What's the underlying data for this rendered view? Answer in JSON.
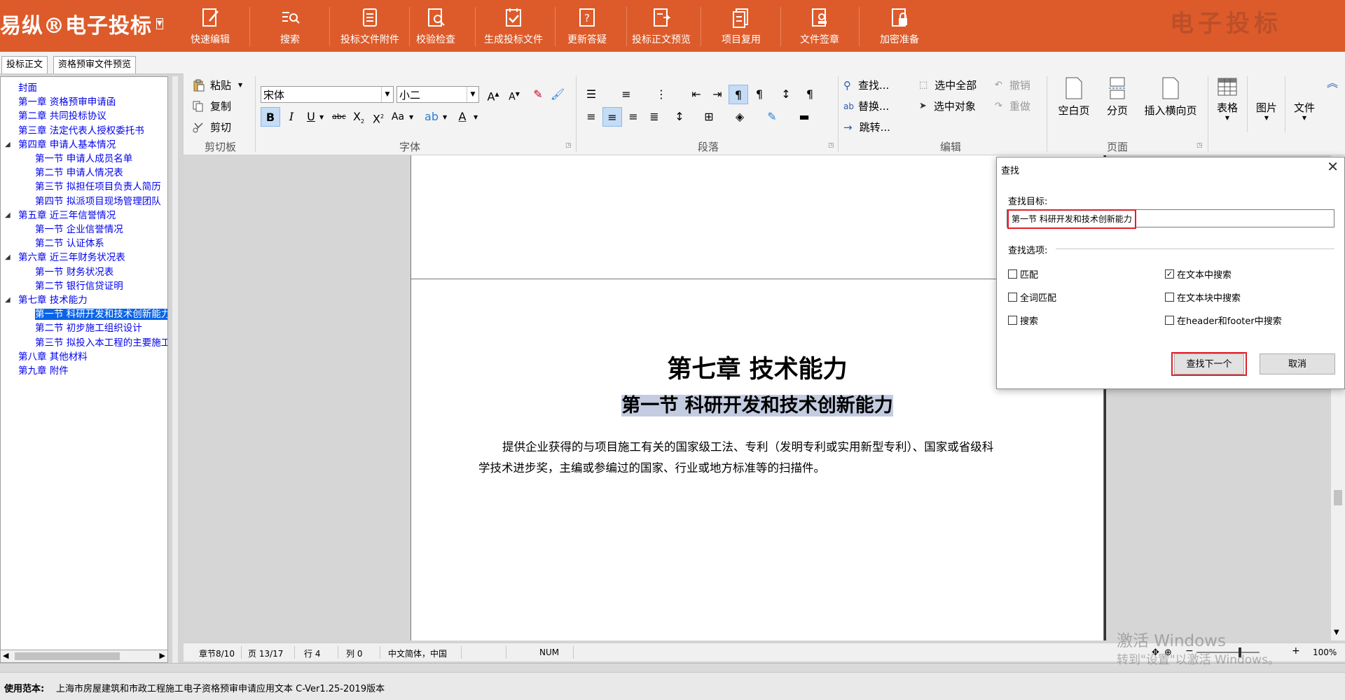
{
  "app": {
    "logo_text": "易纵®电子投标",
    "brand_watermark": "电子投标",
    "accent_color": "#dd5b2a"
  },
  "toolbar": [
    {
      "label": "快速编辑",
      "icon": "edit-icon"
    },
    {
      "label": "搜索",
      "icon": "search-icon"
    },
    {
      "label": "投标文件附件",
      "icon": "attachment-doc-icon"
    },
    {
      "label": "校验检查",
      "icon": "check-doc-icon"
    },
    {
      "label": "生成投标文件",
      "icon": "generate-doc-icon"
    },
    {
      "label": "更新答疑",
      "icon": "question-icon"
    },
    {
      "label": "投标正文预览",
      "icon": "preview-icon"
    },
    {
      "label": "项目复用",
      "icon": "reuse-icon"
    },
    {
      "label": "文件签章",
      "icon": "seal-icon"
    },
    {
      "label": "加密准备",
      "icon": "lock-doc-icon"
    }
  ],
  "tabs": [
    {
      "label": "投标正文",
      "active": true
    },
    {
      "label": "资格预审文件预览",
      "active": false
    }
  ],
  "tree": [
    {
      "label": "封面",
      "level": 0
    },
    {
      "label": "第一章 资格预审申请函",
      "level": 0
    },
    {
      "label": "第二章 共同投标协议",
      "level": 0
    },
    {
      "label": "第三章 法定代表人授权委托书",
      "level": 0
    },
    {
      "label": "第四章 申请人基本情况",
      "level": 0,
      "toggle": "◢"
    },
    {
      "label": "第一节 申请人成员名单",
      "level": 1
    },
    {
      "label": "第二节 申请人情况表",
      "level": 1
    },
    {
      "label": "第三节 拟担任项目负责人简历",
      "level": 1
    },
    {
      "label": "第四节 拟派项目现场管理团队",
      "level": 1
    },
    {
      "label": "第五章 近三年信誉情况",
      "level": 0,
      "toggle": "◢"
    },
    {
      "label": "第一节 企业信誉情况",
      "level": 1
    },
    {
      "label": "第二节 认证体系",
      "level": 1
    },
    {
      "label": "第六章 近三年财务状况表",
      "level": 0,
      "toggle": "◢"
    },
    {
      "label": "第一节 财务状况表",
      "level": 1
    },
    {
      "label": "第二节 银行信贷证明",
      "level": 1
    },
    {
      "label": "第七章 技术能力",
      "level": 0,
      "toggle": "◢"
    },
    {
      "label": "第一节 科研开发和技术创新能力",
      "level": 1,
      "selected": true
    },
    {
      "label": "第二节 初步施工组织设计",
      "level": 1
    },
    {
      "label": "第三节 拟投入本工程的主要施工",
      "level": 1
    },
    {
      "label": "第八章 其他材料",
      "level": 0
    },
    {
      "label": "第九章 附件",
      "level": 0
    }
  ],
  "ribbon": {
    "clipboard": {
      "paste": "粘贴",
      "copy": "复制",
      "cut": "剪切",
      "group": "剪切板"
    },
    "font": {
      "family": "宋体",
      "size": "小二",
      "group": "字体"
    },
    "paragraph": {
      "group": "段落"
    },
    "edit": {
      "find": "查找...",
      "replace": "替换...",
      "goto": "跳转...",
      "select_all": "选中全部",
      "select_object": "选中对象",
      "undo": "撤销",
      "redo": "重做",
      "group": "编辑"
    },
    "page": {
      "blank": "空白页",
      "break": "分页",
      "landscape": "插入横向页",
      "group": "页面"
    },
    "table": "表格",
    "image": "图片",
    "file": "文件"
  },
  "document": {
    "chapter_title": "第七章  技术能力",
    "section_title": "第一节  科研开发和技术创新能力",
    "body_line1": "提供企业获得的与项目施工有关的国家级工法、专利（发明专利或实用新型专利）、国家或省级科",
    "body_line2": "学技术进步奖，主编或参编过的国家、行业或地方标准等的扫描件。"
  },
  "status": {
    "section": "章节8/10",
    "page": "页 13/17",
    "row": "行 4",
    "col": "列 0",
    "lang": "中文简体，中国",
    "num": "NUM",
    "zoom": "100%"
  },
  "find_dialog": {
    "title": "查找",
    "target_label": "查找目标:",
    "target_value": "第一节 科研开发和技术创新能力",
    "options_label": "查找选项:",
    "options": [
      {
        "label": "匹配",
        "checked": false
      },
      {
        "label": "在文本中搜索",
        "checked": true
      },
      {
        "label": "全词匹配",
        "checked": false
      },
      {
        "label": "在文本块中搜索",
        "checked": false
      },
      {
        "label": "搜索",
        "checked": false
      },
      {
        "label": "在header和footer中搜索",
        "checked": false
      }
    ],
    "find_next": "查找下一个",
    "cancel": "取消"
  },
  "footer": {
    "label": "使用范本:",
    "text": "上海市房屋建筑和市政工程施工电子资格预审申请应用文本  C-Ver1.25-2019版本"
  },
  "watermark": {
    "line1": "激活 Windows",
    "line2": "转到\"设置\"以激活 Windows。"
  }
}
